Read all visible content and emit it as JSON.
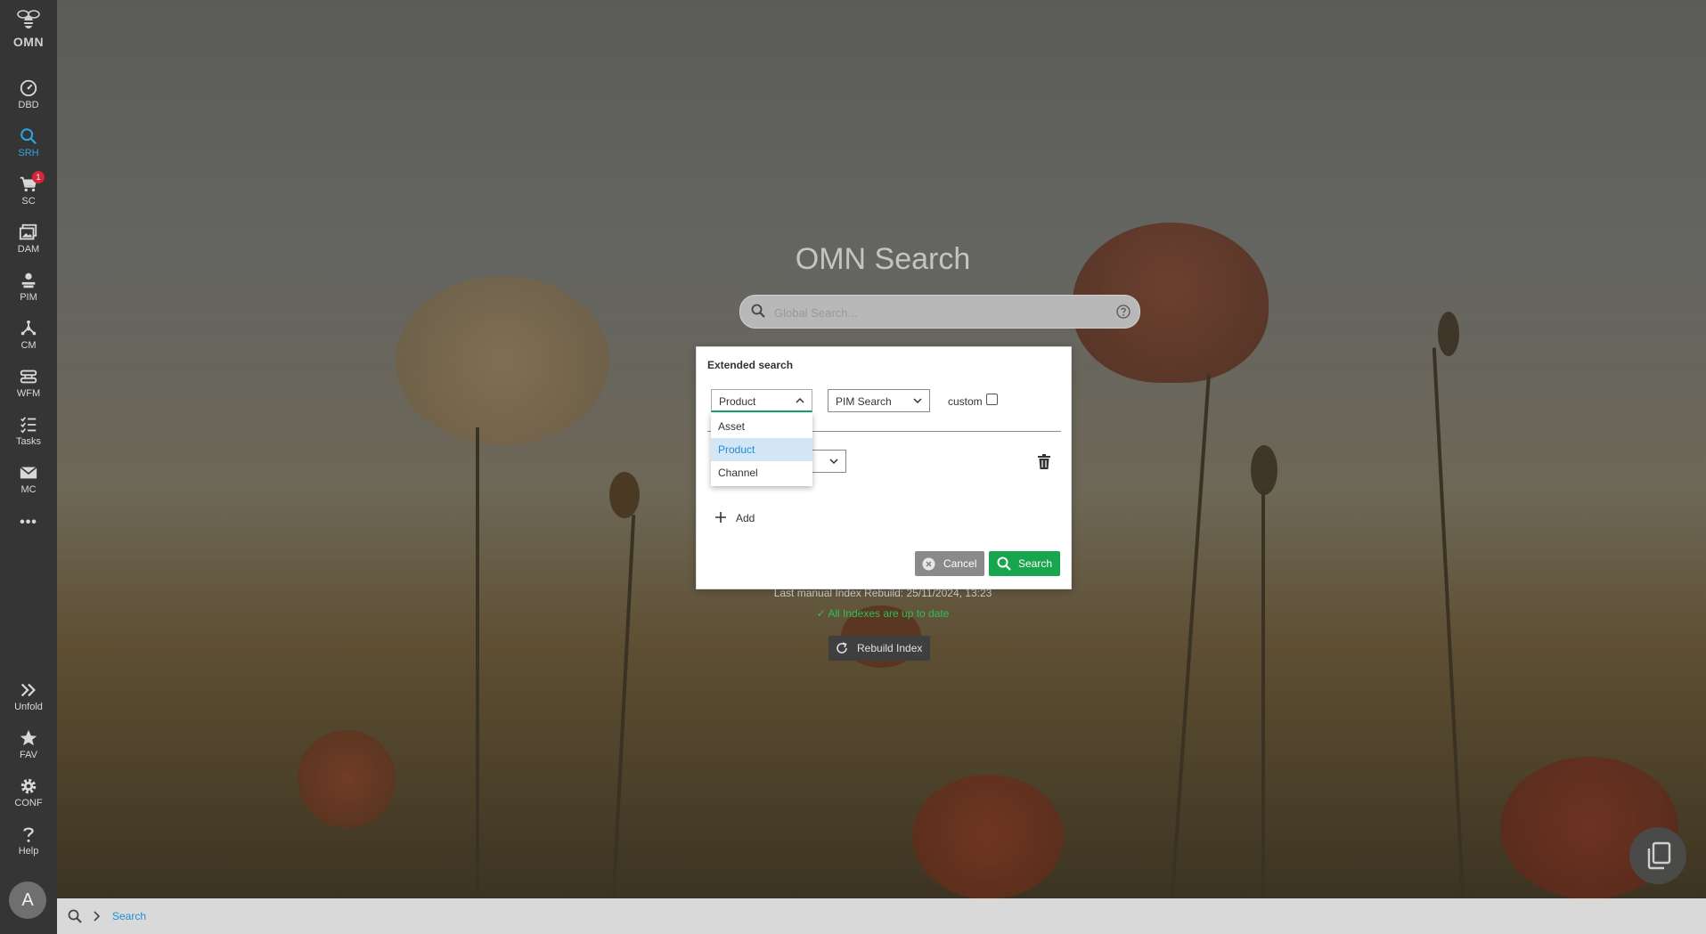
{
  "sidebar": {
    "logo": "OMN",
    "items": [
      {
        "label": "DBD",
        "icon": "dashboard-icon"
      },
      {
        "label": "SRH",
        "icon": "search-icon"
      },
      {
        "label": "SC",
        "icon": "cart-icon",
        "badge": "1"
      },
      {
        "label": "DAM",
        "icon": "images-icon"
      },
      {
        "label": "PIM",
        "icon": "product-icon"
      },
      {
        "label": "CM",
        "icon": "channel-icon"
      },
      {
        "label": "WFM",
        "icon": "workflow-icon"
      },
      {
        "label": "Tasks",
        "icon": "tasks-icon"
      },
      {
        "label": "MC",
        "icon": "mail-icon"
      }
    ],
    "more": "•••",
    "bottom_items": [
      {
        "label": "Unfold",
        "icon": "double-chevron-right-icon"
      },
      {
        "label": "FAV",
        "icon": "star-icon"
      },
      {
        "label": "CONF",
        "icon": "gear-icon"
      },
      {
        "label": "Help",
        "icon": "question-icon"
      }
    ],
    "avatar": "A",
    "active_label": "SRH",
    "accent_color": "#2aa6e0"
  },
  "main": {
    "title": "OMN Search",
    "global_search": {
      "placeholder": "Global Search...",
      "value": ""
    },
    "index_info": "Last manual Index Rebuild: 25/11/2024, 13:23",
    "index_status": "All Indexes are up to date",
    "rebuild_label": "Rebuild Index"
  },
  "modal": {
    "title": "Extended search",
    "type_select": {
      "value": "Product",
      "options": [
        "Asset",
        "Product",
        "Channel"
      ],
      "selected": "Product"
    },
    "search_select": {
      "value": "PIM Search"
    },
    "custom_label": "custom",
    "custom_checked": false,
    "add_label": "Add",
    "cancel_label": "Cancel",
    "search_label": "Search"
  },
  "bottombar": {
    "breadcrumb": "Search"
  },
  "colors": {
    "primary_green": "#17a64d",
    "link_blue": "#1f8ed6",
    "badge_red": "#d6263c",
    "sidebar_bg": "#353535"
  }
}
